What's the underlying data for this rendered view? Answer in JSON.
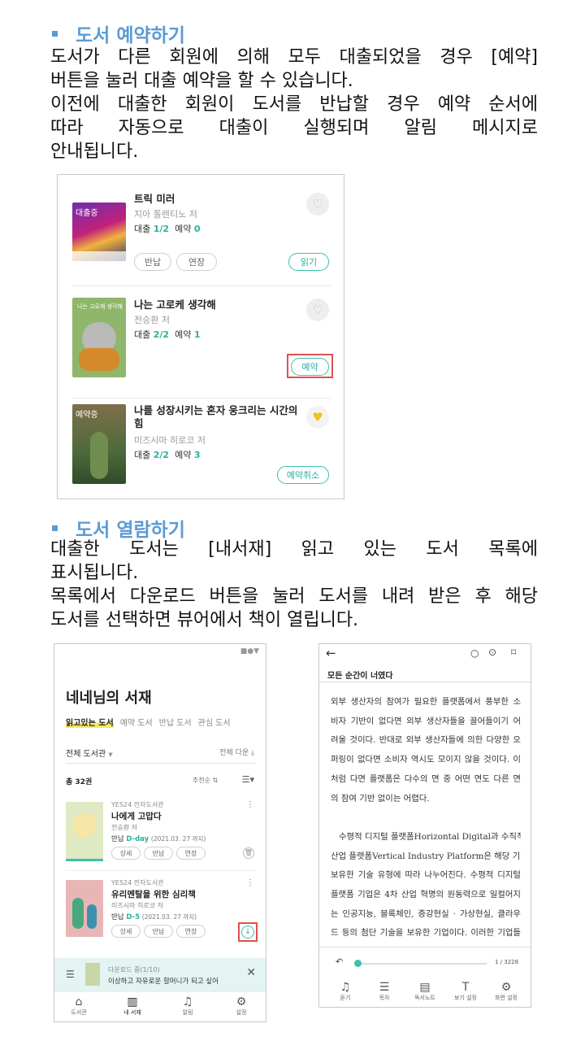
{
  "section1": {
    "heading": "도서 예약하기",
    "lines": [
      "도서가 다른 회원에 의해 모두 대출되었을 경우 [예약]",
      "버튼을 눌러 대출 예약을 할 수 있습니다.",
      "이전에 대출한 회원이 도서를 반납할 경우 예약 순서에",
      "따라 자동으로 대출이 실행되며 알림 메시지로",
      "안내됩니다."
    ]
  },
  "panel1": {
    "books": [
      {
        "cover_tag": "대출중",
        "title": "트릭 미러",
        "author": "지아 톨렌티노 저",
        "stat_loan_label": "대출",
        "stat_loan": "1/2",
        "stat_res_label": "예약",
        "stat_res": "0",
        "buttons": [
          "반납",
          "연장"
        ],
        "action": "읽기"
      },
      {
        "cover_tag": "",
        "title": "나는 고로케 생각해",
        "author": "전승환 저",
        "stat_loan_label": "대출",
        "stat_loan": "2/2",
        "stat_res_label": "예약",
        "stat_res": "1",
        "action": "예약"
      },
      {
        "cover_tag": "예약중",
        "title": "나를 성장시키는 혼자 웅크리는 시간의 힘",
        "author": "미즈시마 히로코 저",
        "stat_loan_label": "대출",
        "stat_loan": "2/2",
        "stat_res_label": "예약",
        "stat_res": "3",
        "action": "예약취소"
      }
    ],
    "cover2_text": "나는 고로케 생각해"
  },
  "section2": {
    "heading": "도서 열람하기",
    "lines": [
      "대출한 도서는 [내서재] 읽고 있는 도서 목록에",
      "표시됩니다.",
      "목록에서 다운로드 버튼을 눌러 도서를 내려 받은 후 해당",
      "도서를 선택하면 뷰어에서 책이 열립니다."
    ]
  },
  "library": {
    "title": "네네님의 서재",
    "tabs": [
      "읽고있는 도서",
      "예약 도서",
      "반납 도서",
      "관심 도서"
    ],
    "filter": "전체 도서관",
    "download_all": "전체 다운",
    "count": "총 32권",
    "sort": "추천순",
    "books": [
      {
        "library": "YES24 전자도서관",
        "title": "나에게 고맙다",
        "author": "전승환 저",
        "due_label": "반납",
        "due": "D-day",
        "due_date": "(2021.03. 27 까지)",
        "buttons": [
          "상세",
          "반납",
          "연장"
        ]
      },
      {
        "library": "YES24 전자도서관",
        "title": "유리멘탈을 위한 심리책",
        "author": "미즈시마 히로코 저",
        "due_label": "반납",
        "due": "D-5",
        "due_date": "(2021.03. 27 까지)",
        "buttons": [
          "상세",
          "반납",
          "연장"
        ]
      }
    ],
    "download_status": "다운로드 중(1/10)",
    "download_title": "이상하고 자유로운 할머니가 되고 싶어",
    "nav": [
      "도서관",
      "내 서재",
      "알림",
      "설정"
    ]
  },
  "viewer": {
    "book_title": "모든 순간이 너였다",
    "lines": [
      "외부 생산자의 참여가 필요한 플랫폼에서 풍부한 소",
      "비자 기반이 없다면 외부 생산자들을 끌어들이기 어",
      "려울 것이다. 반대로 외부 생산자들에 의한 다양한 오",
      "퍼링이 없다면 소비자 역시도 모이지 않을 것이다. 이",
      "처럼 다면 플랫폼은 다수의 면 중 어떤 면도 다른 면",
      "의 참여 기반 없이는 어렵다."
    ],
    "lines2": [
      "수평적 디지털 플랫폼Horizontal Digital과 수직적",
      "산업 플랫폼Vertical Industry Platform은 해당 기업이",
      "보유한 기술 유형에 따라 나누어진다. 수평적 디지털",
      "플랫폼 기업은 4차 산업 혁명의 원동력으로 일컬어지",
      "는 인공지능, 블록체인, 증강현실 · 가상현실, 클라우",
      "드 등의 첨단 기술을 보유한 기업이다. 이러한 기업들"
    ],
    "page": "1 / 3228",
    "nav": [
      "듣기",
      "목차",
      "독서노트",
      "보기 설정",
      "화면 설정"
    ]
  }
}
